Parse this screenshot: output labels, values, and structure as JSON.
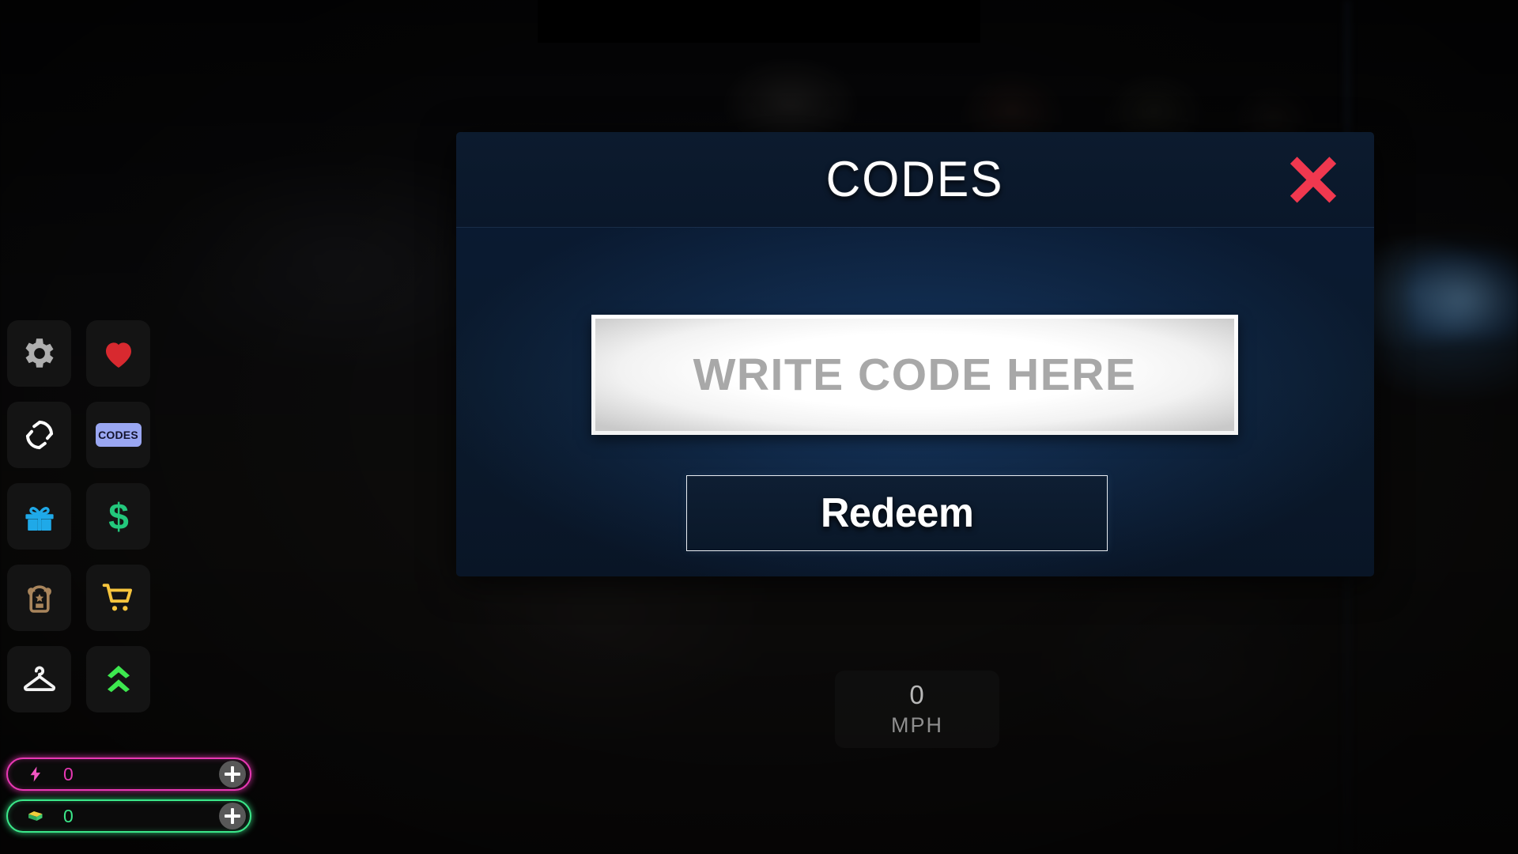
{
  "game": {
    "speedometer": {
      "value": "0",
      "unit": "MPH"
    }
  },
  "sidebar": {
    "items": [
      {
        "name": "settings",
        "icon": "gear-icon",
        "label": "Settings"
      },
      {
        "name": "favorites",
        "icon": "heart-icon",
        "label": "Favorites"
      },
      {
        "name": "rejoin",
        "icon": "refresh-icon",
        "label": "Rejoin"
      },
      {
        "name": "codes",
        "icon": "codes-icon",
        "label": "CODES"
      },
      {
        "name": "gifts",
        "icon": "gift-icon",
        "label": "Gifts"
      },
      {
        "name": "money",
        "icon": "dollar-icon",
        "label": "Money"
      },
      {
        "name": "inventory",
        "icon": "backpack-icon",
        "label": "Inventory"
      },
      {
        "name": "shop",
        "icon": "cart-icon",
        "label": "Shop"
      },
      {
        "name": "wardrobe",
        "icon": "hanger-icon",
        "label": "Wardrobe"
      },
      {
        "name": "upgrades",
        "icon": "chevrons-up-icon",
        "label": "Upgrades"
      }
    ]
  },
  "currencies": [
    {
      "name": "energy",
      "icon": "lightning-bolt-icon",
      "value": "0",
      "plus_label": "+",
      "color": "#E838B4"
    },
    {
      "name": "cash",
      "icon": "money-stack-icon",
      "value": "0",
      "plus_label": "+",
      "color": "#3BE88A"
    }
  ],
  "dialog": {
    "title": "CODES",
    "close_icon": "close-x-icon",
    "close_color": "#F0384F",
    "input": {
      "value": "",
      "placeholder": "WRITE CODE HERE"
    },
    "redeem_label": "Redeem"
  }
}
